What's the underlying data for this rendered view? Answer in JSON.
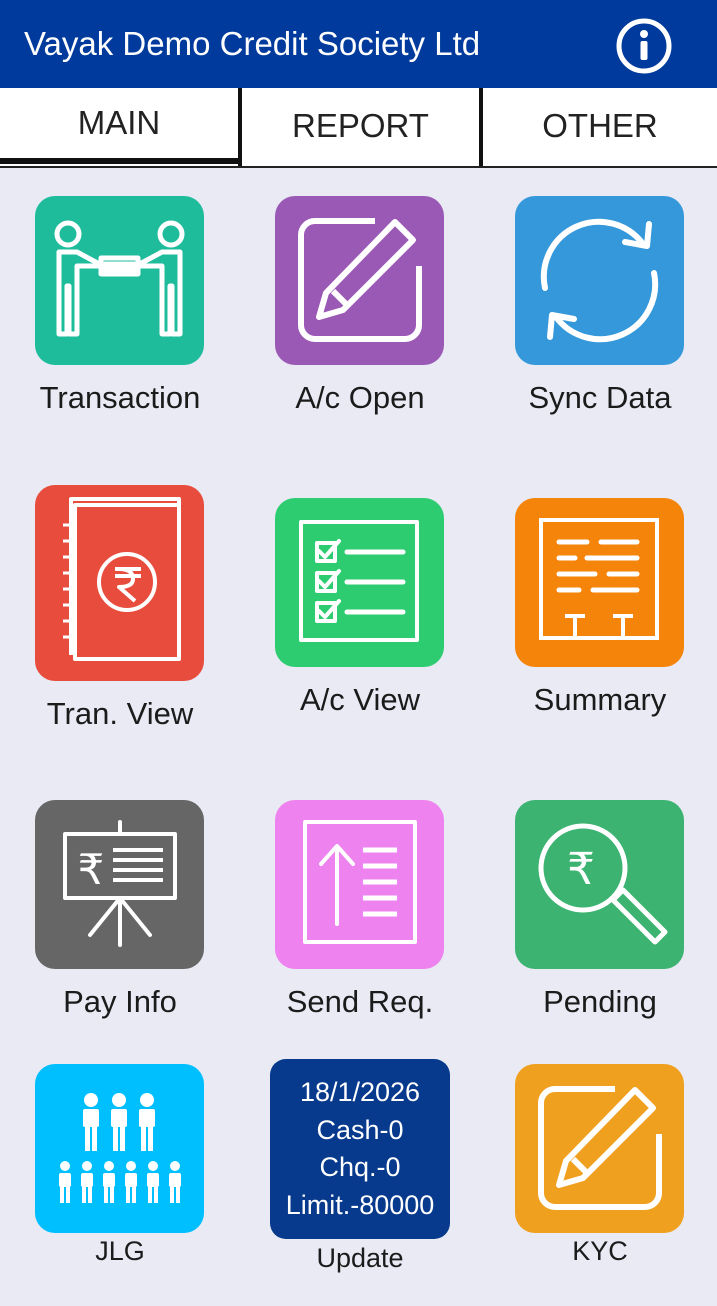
{
  "header": {
    "title": "Vayak Demo Credit Society Ltd",
    "info_icon": "info-circle-icon",
    "background": "#003a9c"
  },
  "tabs": [
    {
      "label": "MAIN",
      "active": true
    },
    {
      "label": "REPORT",
      "active": false
    },
    {
      "label": "OTHER",
      "active": false
    }
  ],
  "tiles": [
    {
      "label": "Transaction",
      "icon": "cash-handover-icon",
      "color": "#1fbc9c"
    },
    {
      "label": "A/c Open",
      "icon": "edit-pencil-icon",
      "color": "#9b59b6"
    },
    {
      "label": "Sync Data",
      "icon": "sync-arrows-icon",
      "color": "#3498db"
    },
    {
      "label": "Tran. View",
      "icon": "rupee-ledger-icon",
      "color": "#e74c3c"
    },
    {
      "label": "A/c View",
      "icon": "checklist-icon",
      "color": "#2ecc71"
    },
    {
      "label": "Summary",
      "icon": "summary-report-icon",
      "color": "#f39c12"
    },
    {
      "label": "Pay Info",
      "icon": "rupee-presentation-icon",
      "color": "#666666"
    },
    {
      "label": "Send Req.",
      "icon": "upload-list-icon",
      "color": "#ee82ee"
    },
    {
      "label": "Pending",
      "icon": "rupee-search-icon",
      "color": "#3cb371"
    },
    {
      "label": "JLG",
      "icon": "group-people-icon",
      "color": "#00bfff"
    },
    {
      "label": "Update",
      "icon": "",
      "color": "#073a8c"
    },
    {
      "label": "KYC",
      "icon": "edit-pencil-icon",
      "color": "#f0a01f"
    }
  ],
  "update_info": {
    "date": "18/1/2026",
    "cash": "Cash-0",
    "cheque": "Chq.-0",
    "limit": "Limit.-80000"
  }
}
